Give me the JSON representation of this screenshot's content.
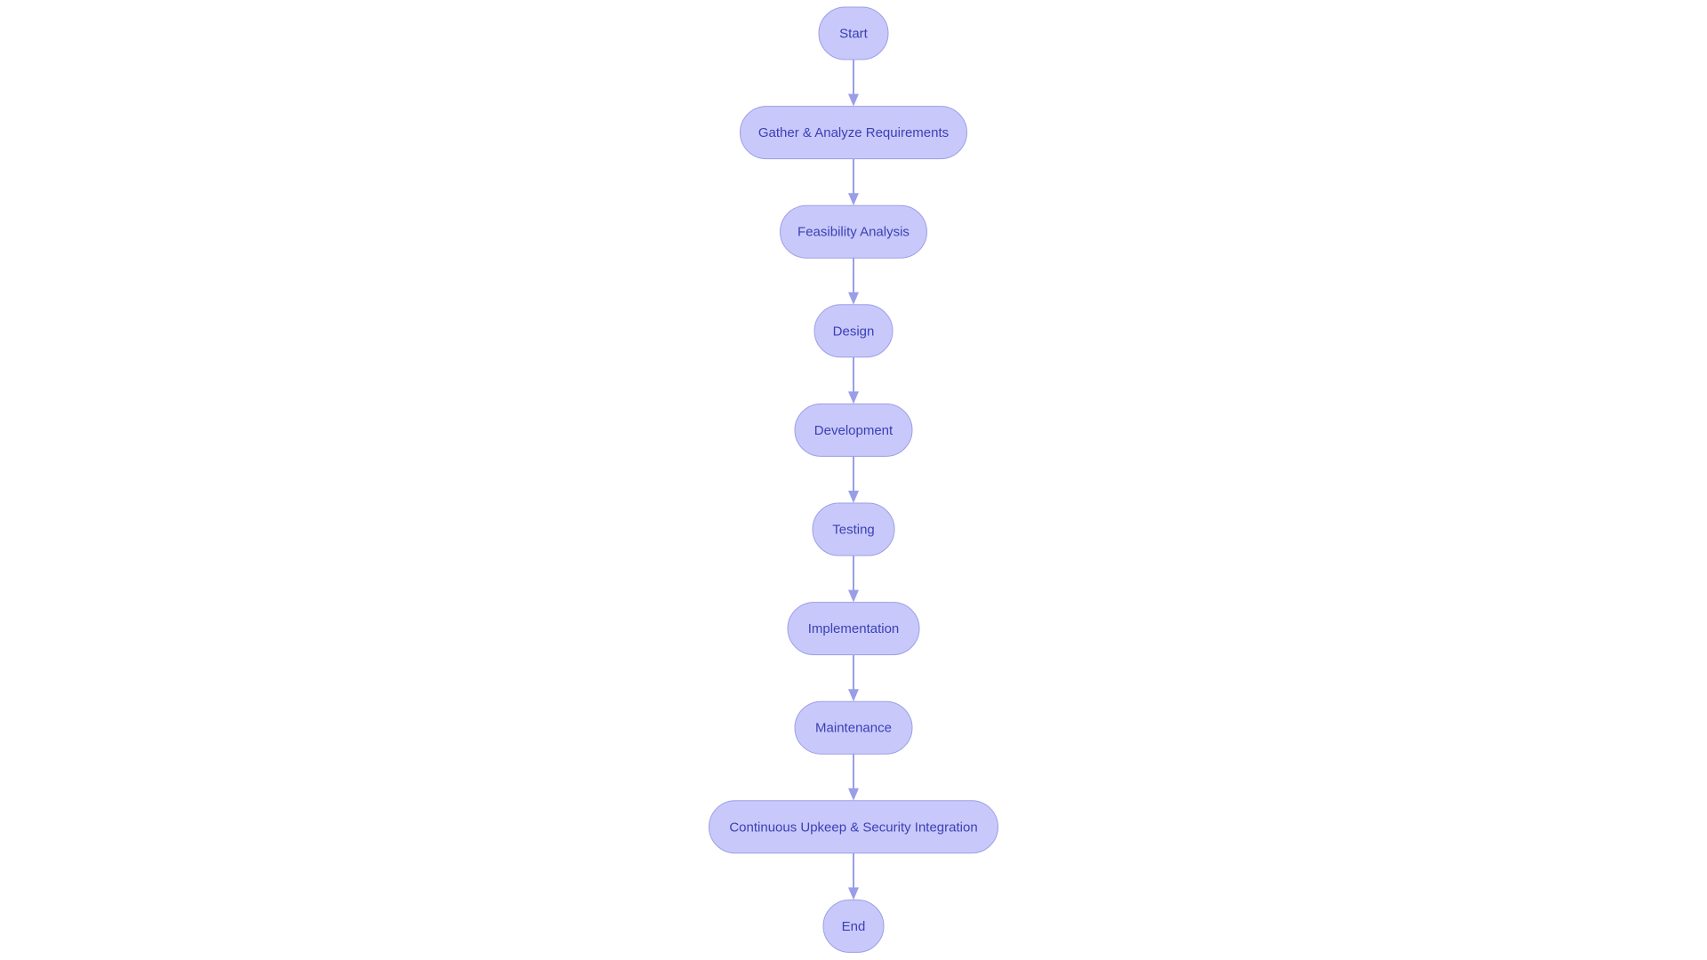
{
  "diagram": {
    "type": "flowchart",
    "direction": "top-to-bottom",
    "colors": {
      "node_fill": "#c8c9fa",
      "node_stroke": "#9c9fe6",
      "text": "#3b3fb5",
      "edge": "#9a9ee8"
    },
    "nodes": [
      {
        "id": "start",
        "label": "Start"
      },
      {
        "id": "gather",
        "label": "Gather & Analyze Requirements"
      },
      {
        "id": "feasibility",
        "label": "Feasibility Analysis"
      },
      {
        "id": "design",
        "label": "Design"
      },
      {
        "id": "development",
        "label": "Development"
      },
      {
        "id": "testing",
        "label": "Testing"
      },
      {
        "id": "implementation",
        "label": "Implementation"
      },
      {
        "id": "maintenance",
        "label": "Maintenance"
      },
      {
        "id": "continuous",
        "label": "Continuous Upkeep & Security Integration"
      },
      {
        "id": "end",
        "label": "End"
      }
    ],
    "edges": [
      {
        "from": "start",
        "to": "gather"
      },
      {
        "from": "gather",
        "to": "feasibility"
      },
      {
        "from": "feasibility",
        "to": "design"
      },
      {
        "from": "design",
        "to": "development"
      },
      {
        "from": "development",
        "to": "testing"
      },
      {
        "from": "testing",
        "to": "implementation"
      },
      {
        "from": "implementation",
        "to": "maintenance"
      },
      {
        "from": "maintenance",
        "to": "continuous"
      },
      {
        "from": "continuous",
        "to": "end"
      }
    ]
  }
}
